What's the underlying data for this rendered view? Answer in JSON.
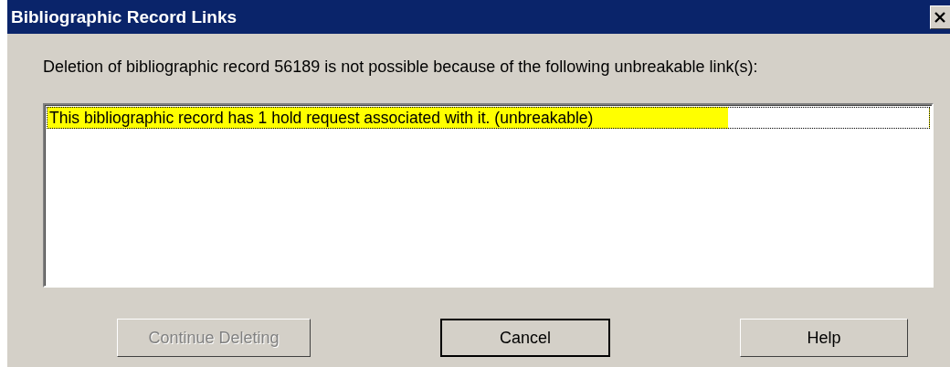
{
  "window": {
    "title": "Bibliographic Record Links"
  },
  "message": "Deletion of bibliographic record 56189 is not possible because of the following unbreakable link(s):",
  "links": [
    {
      "text": "This bibliographic record has 1 hold request associated with it. (unbreakable)",
      "selected": true,
      "highlighted": true
    }
  ],
  "buttons": [
    {
      "label": "Continue Deleting",
      "disabled": true,
      "default": false
    },
    {
      "label": "Cancel",
      "disabled": false,
      "default": true
    },
    {
      "label": "Help",
      "disabled": false,
      "default": false
    }
  ]
}
